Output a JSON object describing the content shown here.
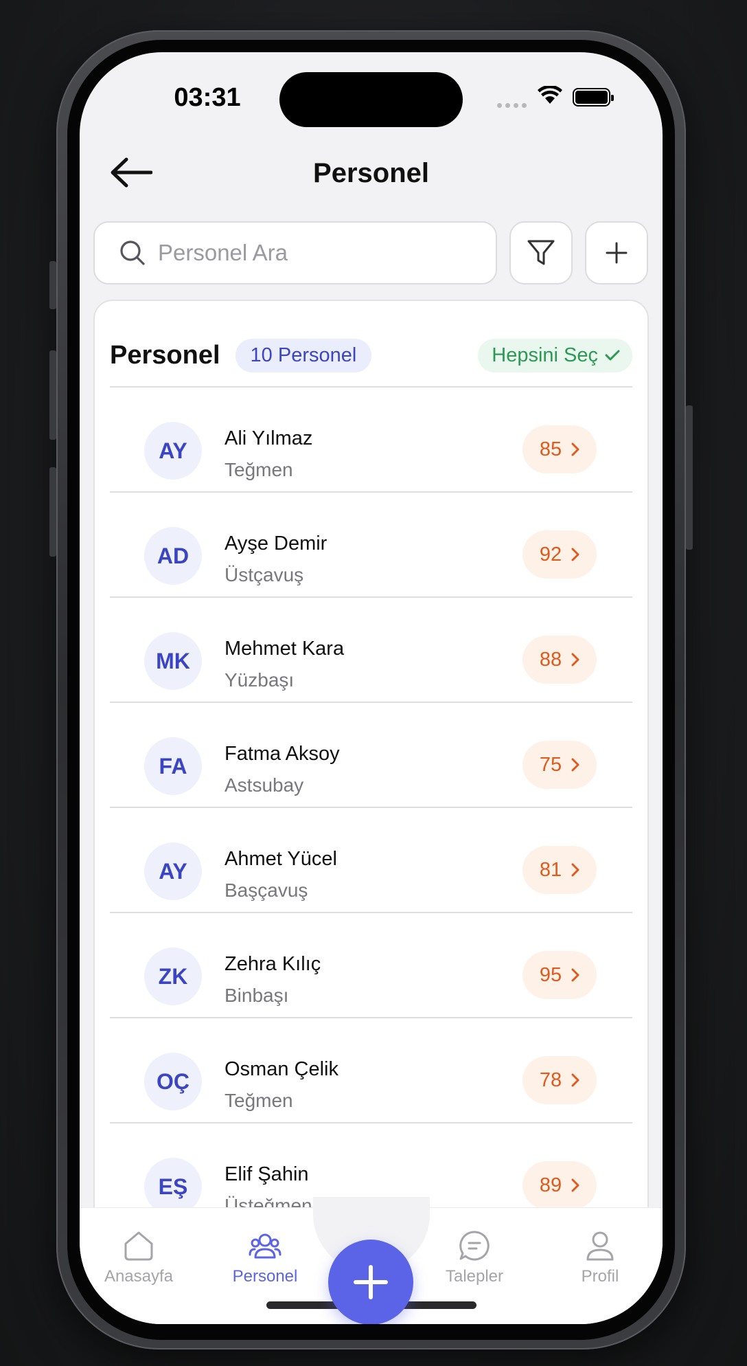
{
  "status_bar": {
    "time": "03:31"
  },
  "header": {
    "title": "Personel"
  },
  "search": {
    "placeholder": "Personel Ara",
    "value": ""
  },
  "list": {
    "title": "Personel",
    "count_badge": "10 Personel",
    "select_all": "Hepsini Seç",
    "items": [
      {
        "initials": "AY",
        "name": "Ali Yılmaz",
        "rank": "Teğmen",
        "score": "85"
      },
      {
        "initials": "AD",
        "name": "Ayşe Demir",
        "rank": "Üstçavuş",
        "score": "92"
      },
      {
        "initials": "MK",
        "name": "Mehmet Kara",
        "rank": "Yüzbaşı",
        "score": "88"
      },
      {
        "initials": "FA",
        "name": "Fatma Aksoy",
        "rank": "Astsubay",
        "score": "75"
      },
      {
        "initials": "AY",
        "name": "Ahmet Yücel",
        "rank": "Başçavuş",
        "score": "81"
      },
      {
        "initials": "ZK",
        "name": "Zehra Kılıç",
        "rank": "Binbaşı",
        "score": "95"
      },
      {
        "initials": "OÇ",
        "name": "Osman Çelik",
        "rank": "Teğmen",
        "score": "78"
      },
      {
        "initials": "EŞ",
        "name": "Elif Şahin",
        "rank": "Üsteğmen",
        "score": "89"
      }
    ]
  },
  "tabbar": {
    "tabs": [
      {
        "label": "Anasayfa",
        "icon": "home-icon",
        "active": false
      },
      {
        "label": "Personel",
        "icon": "users-icon",
        "active": true
      },
      {
        "label": "Talepler",
        "icon": "chat-icon",
        "active": false
      },
      {
        "label": "Profil",
        "icon": "user-icon",
        "active": false
      }
    ],
    "fab_icon": "plus-icon"
  },
  "colors": {
    "accent": "#5b64e6",
    "badge_blue": "#3b45c4",
    "success": "#2c9a55",
    "score_orange": "#e05a1c"
  }
}
